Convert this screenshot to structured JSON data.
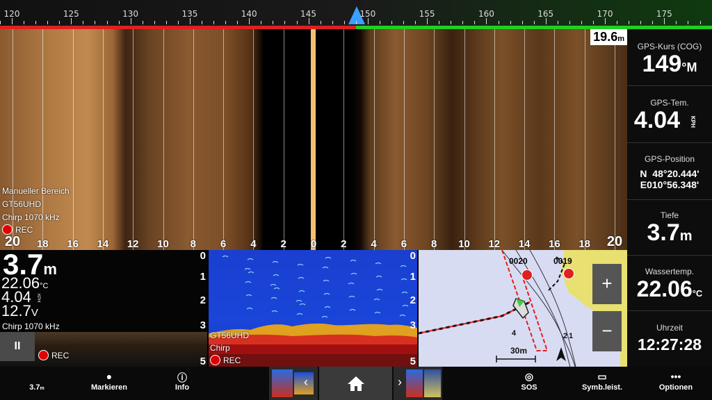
{
  "compass": {
    "labels": [
      "120",
      "125",
      "130",
      "135",
      "140",
      "145",
      "150",
      "155",
      "160",
      "165",
      "170",
      "175"
    ]
  },
  "sidevision": {
    "range_badge": "19.6",
    "range_unit": "m",
    "mode_label": "Manueller Bereich",
    "transducer": "GT56UHD",
    "frequency": "Chirp 1070 kHz",
    "rec": "REC",
    "scale": [
      "20",
      "18",
      "16",
      "14",
      "12",
      "10",
      "8",
      "6",
      "4",
      "2",
      "0",
      "2",
      "4",
      "6",
      "8",
      "10",
      "12",
      "14",
      "16",
      "18",
      "20"
    ]
  },
  "data_panel": {
    "cog_title": "GPS-Kurs (COG)",
    "cog_value": "149",
    "cog_unit": "°M",
    "sog_title": "GPS-Tem.",
    "sog_value": "4.04",
    "sog_unit": "KPH",
    "pos_title": "GPS-Position",
    "pos_lat": "N  48°20.444'",
    "pos_lon": "E010°56.348'",
    "depth_title": "Tiefe",
    "depth_value": "3.7",
    "depth_unit": "m",
    "temp_title": "Wassertemp.",
    "temp_value": "22.06",
    "temp_unit": "°C",
    "time_title": "Uhrzeit",
    "time_value": "12:27:28"
  },
  "downvision": {
    "depth": "3.7",
    "depth_unit": "m",
    "temp": "22.06",
    "temp_unit": "°C",
    "speed": "4.04",
    "speed_unit": "KPH",
    "voltage": "12.7",
    "voltage_unit": "V",
    "frequency": "Chirp 1070 kHz",
    "rec": "REC",
    "pause": "II"
  },
  "sonar": {
    "depth_scale": [
      "0",
      "1",
      "2",
      "3",
      "5"
    ],
    "transducer": "GT56UHD",
    "mode": "Chirp",
    "rec": "REC"
  },
  "chart": {
    "waypoint1": "0020",
    "waypoint2": "0019",
    "scale_label": "30m",
    "zoom_in": "+",
    "zoom_out": "−",
    "depth_scale": [
      "0",
      "1",
      "2",
      "3",
      "5"
    ],
    "contour_labels": [
      "4",
      "2",
      "1"
    ]
  },
  "bottom_bar": {
    "depth_readout": "3.7",
    "depth_unit": "m",
    "mark_label": "Markieren",
    "info_label": "Info",
    "sos_label": "SOS",
    "toolbar_label": "Symb.leist.",
    "options_label": "Optionen"
  },
  "colors": {
    "accent_blue": "#3aa0ff",
    "rec_red": "#e00000",
    "port_red": "#e02020",
    "stbd_green": "#20d020"
  }
}
